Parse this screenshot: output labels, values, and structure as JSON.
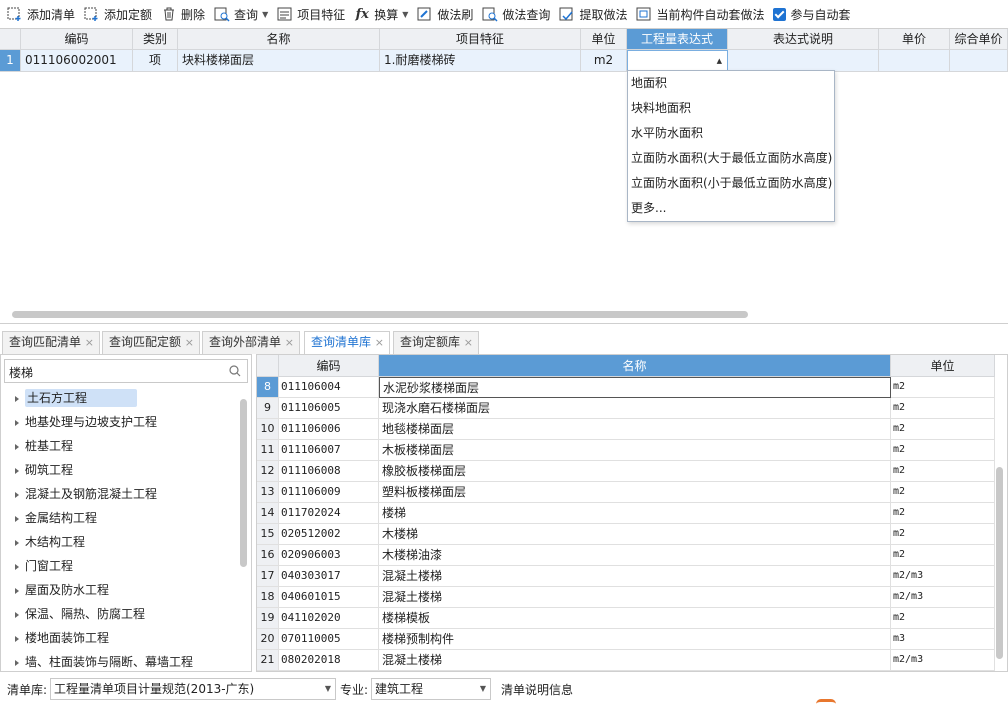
{
  "toolbar": {
    "add_list": "添加清单",
    "add_quota": "添加定额",
    "delete": "删除",
    "query": "查询",
    "item_feature": "项目特征",
    "convert": "换算",
    "method_brush": "做法刷",
    "method_query": "做法查询",
    "extract_method": "提取做法",
    "auto_apply": "当前构件自动套做法",
    "participate_auto": "参与自动套"
  },
  "grid": {
    "headers": [
      "编码",
      "类别",
      "名称",
      "项目特征",
      "单位",
      "工程量表达式",
      "表达式说明",
      "单价",
      "综合单价"
    ],
    "row": {
      "num": "1",
      "code": "011106002001",
      "category": "项",
      "name": "块料楼梯面层",
      "feature": "1.耐磨楼梯砖",
      "unit": "m2"
    }
  },
  "dropdown": {
    "items": [
      "地面积",
      "块料地面积",
      "水平防水面积",
      "立面防水面积(大于最低立面防水高度)",
      "立面防水面积(小于最低立面防水高度)",
      "更多..."
    ]
  },
  "tabs": [
    "查询匹配清单",
    "查询匹配定额",
    "查询外部清单",
    "查询清单库",
    "查询定额库"
  ],
  "tree": {
    "search_value": "楼梯",
    "items": [
      "土石方工程",
      "地基处理与边坡支护工程",
      "桩基工程",
      "砌筑工程",
      "混凝土及钢筋混凝土工程",
      "金属结构工程",
      "木结构工程",
      "门窗工程",
      "屋面及防水工程",
      "保温、隔热、防腐工程",
      "楼地面装饰工程",
      "墙、柱面装饰与隔断、幕墙工程"
    ]
  },
  "list": {
    "headers": [
      "编码",
      "名称",
      "单位"
    ],
    "rows": [
      {
        "num": "8",
        "code": "011106004",
        "name": "水泥砂浆楼梯面层",
        "unit": "m2"
      },
      {
        "num": "9",
        "code": "011106005",
        "name": "现浇水磨石楼梯面层",
        "unit": "m2"
      },
      {
        "num": "10",
        "code": "011106006",
        "name": "地毯楼梯面层",
        "unit": "m2"
      },
      {
        "num": "11",
        "code": "011106007",
        "name": "木板楼梯面层",
        "unit": "m2"
      },
      {
        "num": "12",
        "code": "011106008",
        "name": "橡胶板楼梯面层",
        "unit": "m2"
      },
      {
        "num": "13",
        "code": "011106009",
        "name": "塑料板楼梯面层",
        "unit": "m2"
      },
      {
        "num": "14",
        "code": "011702024",
        "name": "楼梯",
        "unit": "m2"
      },
      {
        "num": "15",
        "code": "020512002",
        "name": "木楼梯",
        "unit": "m2"
      },
      {
        "num": "16",
        "code": "020906003",
        "name": "木楼梯油漆",
        "unit": "m2"
      },
      {
        "num": "17",
        "code": "040303017",
        "name": "混凝土楼梯",
        "unit": "m2/m3"
      },
      {
        "num": "18",
        "code": "040601015",
        "name": "混凝土楼梯",
        "unit": "m2/m3"
      },
      {
        "num": "19",
        "code": "041102020",
        "name": "楼梯模板",
        "unit": "m2"
      },
      {
        "num": "20",
        "code": "070110005",
        "name": "楼梯预制构件",
        "unit": "m3"
      },
      {
        "num": "21",
        "code": "080202018",
        "name": "混凝土楼梯",
        "unit": "m2/m3"
      }
    ]
  },
  "bottom": {
    "lib_label": "清单库:",
    "lib_value": "工程量清单项目计量规范(2013-广东)",
    "major_label": "专业:",
    "major_value": "建筑工程",
    "info_label": "清单说明信息"
  }
}
